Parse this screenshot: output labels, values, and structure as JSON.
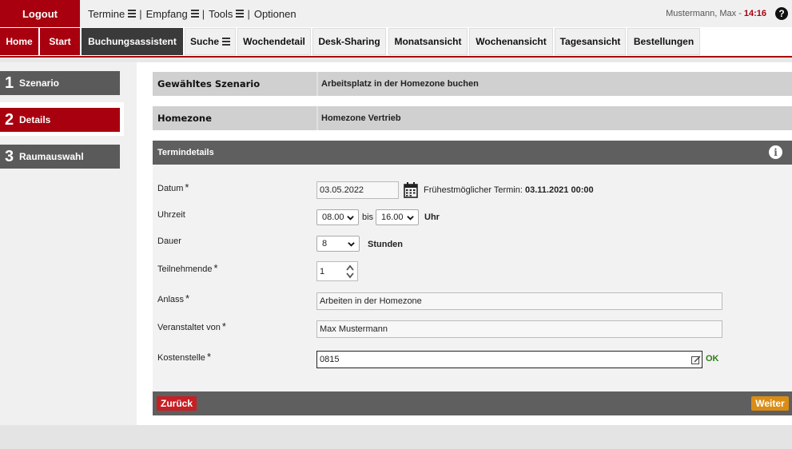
{
  "topbar": {
    "logout_label": "Logout",
    "menu": [
      {
        "label": "Termine",
        "has_menu_icon": true
      },
      {
        "label": "Empfang",
        "has_menu_icon": true
      },
      {
        "label": "Tools",
        "has_menu_icon": true
      },
      {
        "label": "Optionen",
        "has_menu_icon": false
      }
    ],
    "separator": "|",
    "user_name": "Mustermann, Max -",
    "time": "14:16",
    "help_label": "?"
  },
  "nav": {
    "tabs": [
      {
        "label": "Home",
        "style": "red"
      },
      {
        "label": "Start",
        "style": "red"
      },
      {
        "label": "Buchungsassistent",
        "style": "dark"
      },
      {
        "label": "Suche",
        "style": "light",
        "has_menu_icon": true
      },
      {
        "label": "Wochendetail",
        "style": "light"
      },
      {
        "label": "Desk-Sharing",
        "style": "light"
      },
      {
        "label": "Monatsansicht",
        "style": "light"
      },
      {
        "label": "Wochenansicht",
        "style": "light"
      },
      {
        "label": "Tagesansicht",
        "style": "light"
      },
      {
        "label": "Bestellungen",
        "style": "light"
      }
    ]
  },
  "steps": [
    {
      "number": "1",
      "label": "Szenario"
    },
    {
      "number": "2",
      "label": "Details"
    },
    {
      "number": "3",
      "label": "Raumauswahl"
    }
  ],
  "summary": {
    "scenario_label": "Gewähltes Szenario",
    "scenario_value": "Arbeitsplatz in der Homezone buchen",
    "homezone_label": "Homezone",
    "homezone_value": "Homezone Vertrieb"
  },
  "section": {
    "title": "Termindetails",
    "info_icon": "i"
  },
  "form": {
    "required_mark": "*",
    "datum": {
      "label": "Datum",
      "value": "03.05.2022",
      "earliest_label": "Frühestmöglicher Termin:",
      "earliest_value": "03.11.2021 00:00"
    },
    "uhrzeit": {
      "label": "Uhrzeit",
      "from": "08.00",
      "bis": "bis",
      "to": "16.00",
      "unit": "Uhr"
    },
    "dauer": {
      "label": "Dauer",
      "value": "8",
      "unit": "Stunden"
    },
    "teilnehmende": {
      "label": "Teilnehmende",
      "value": "1"
    },
    "anlass": {
      "label": "Anlass",
      "value": "Arbeiten in der Homezone"
    },
    "veranstaltet": {
      "label": "Veranstaltet von",
      "value": "Max Mustermann"
    },
    "kostenstelle": {
      "label": "Kostenstelle",
      "value": "0815",
      "status": "OK"
    }
  },
  "buttons": {
    "back": "Zurück",
    "next": "Weiter"
  },
  "colors": {
    "brand_red": "#a8000e",
    "dark": "#3a3a3a",
    "section_grey": "#5f5f5f",
    "ok_green": "#2e7d16",
    "next_orange": "#d98d14"
  }
}
